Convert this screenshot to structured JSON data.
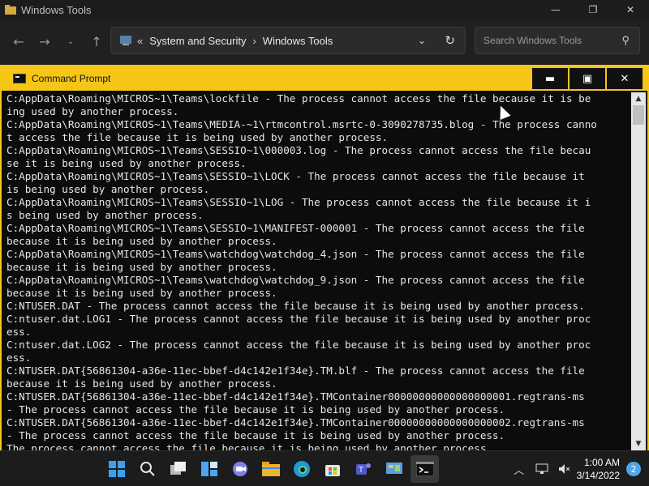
{
  "explorer": {
    "title": "Windows Tools",
    "breadcrumbs": [
      "System and Security",
      "Windows Tools"
    ],
    "search_placeholder": "Search Windows Tools"
  },
  "cmd": {
    "title": "Command Prompt",
    "lines": [
      "C:AppData\\Roaming\\MICROS~1\\Teams\\lockfile - The process cannot access the file because it is be",
      "ing used by another process.",
      "C:AppData\\Roaming\\MICROS~1\\Teams\\MEDIA-~1\\rtmcontrol.msrtc-0-3090278735.blog - The process canno",
      "t access the file because it is being used by another process.",
      "C:AppData\\Roaming\\MICROS~1\\Teams\\SESSIO~1\\000003.log - The process cannot access the file becau",
      "se it is being used by another process.",
      "C:AppData\\Roaming\\MICROS~1\\Teams\\SESSIO~1\\LOCK - The process cannot access the file because it",
      "is being used by another process.",
      "C:AppData\\Roaming\\MICROS~1\\Teams\\SESSIO~1\\LOG - The process cannot access the file because it i",
      "s being used by another process.",
      "C:AppData\\Roaming\\MICROS~1\\Teams\\SESSIO~1\\MANIFEST-000001 - The process cannot access the file",
      "because it is being used by another process.",
      "C:AppData\\Roaming\\MICROS~1\\Teams\\watchdog\\watchdog_4.json - The process cannot access the file",
      "because it is being used by another process.",
      "C:AppData\\Roaming\\MICROS~1\\Teams\\watchdog\\watchdog_9.json - The process cannot access the file",
      "because it is being used by another process.",
      "C:NTUSER.DAT - The process cannot access the file because it is being used by another process.",
      "C:ntuser.dat.LOG1 - The process cannot access the file because it is being used by another proc",
      "ess.",
      "C:ntuser.dat.LOG2 - The process cannot access the file because it is being used by another proc",
      "ess.",
      "C:NTUSER.DAT{56861304-a36e-11ec-bbef-d4c142e1f34e}.TM.blf - The process cannot access the file",
      "because it is being used by another process.",
      "C:NTUSER.DAT{56861304-a36e-11ec-bbef-d4c142e1f34e}.TMContainer00000000000000000001.regtrans-ms",
      "- The process cannot access the file because it is being used by another process.",
      "C:NTUSER.DAT{56861304-a36e-11ec-bbef-d4c142e1f34e}.TMContainer00000000000000000002.regtrans-ms",
      "- The process cannot access the file because it is being used by another process.",
      "The process cannot access the file because it is being used by another process."
    ]
  },
  "taskbar": {
    "time": "1:00 AM",
    "date": "3/14/2022",
    "notification_count": "2"
  }
}
